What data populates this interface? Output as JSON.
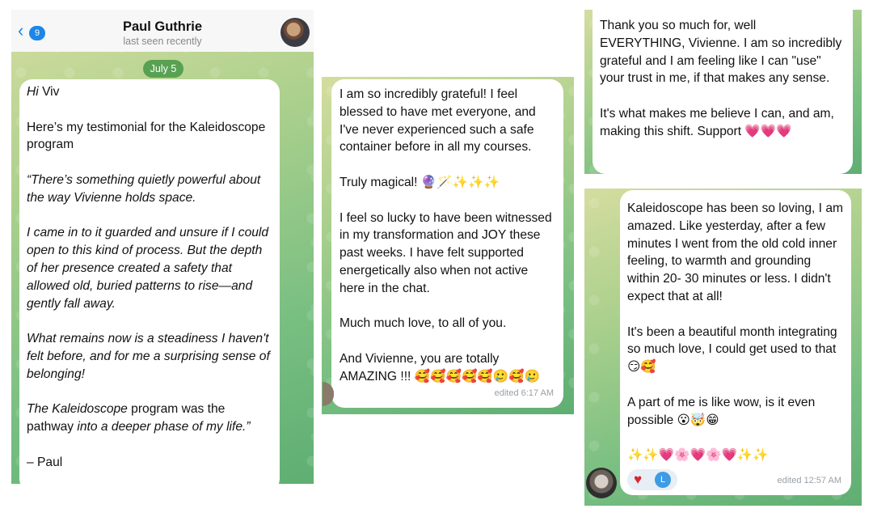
{
  "panel1": {
    "header": {
      "back_count": "9",
      "name": "Paul Guthrie",
      "status": "last seen recently"
    },
    "date": "July 5",
    "message": {
      "greeting_italic": "Hi",
      "greeting_rest": " Viv",
      "intro": "Here’s my testimonial for the Kaleidoscope program",
      "para1": "“There’s something quietly powerful about the way Vivienne holds space.",
      "para2": "I came in to it guarded and unsure if I could open to this kind of process. But the depth of her presence created a safety that allowed old, buried patterns to rise—and gently fall away.",
      "para3_a": "What remains now is a steadiness I haven't ",
      "para3_b": "felt before, and for me a surprising sense of belonging!",
      "para4_a": "The Kaleidoscope",
      "para4_b": " program was the pathway ",
      "para4_c": "into a deeper phase of my life.”",
      "signoff": "– Paul"
    }
  },
  "panel2": {
    "message": {
      "para1": "I am so incredibly grateful! I feel blessed to have met everyone, and I've never experienced such a safe container before in all my courses.",
      "para2_text": "Truly magical! ",
      "para2_emoji": "🔮🪄✨✨✨",
      "para3": "I feel so lucky to have been witnessed in my transformation and JOY these past weeks. I have felt supported energetically also when not active here in the chat.",
      "para4": "Much much love, to all of you.",
      "para5_text": "And Vivienne,  you are totally AMAZING !!! ",
      "para5_emoji": "🥰🥰🥰🥰🥰🥲🥰🥲",
      "meta": "edited 6:17 AM"
    }
  },
  "panel3": {
    "message": {
      "para1": "Thank you so much for, well EVERYTHING, Vivienne. I am so incredibly grateful and I am feeling like I can \"use\" your trust in me, if that makes any sense.",
      "para2_text": "It's what makes me believe I can, and am, making this shift. Support ",
      "para2_emoji": "💗💗💗"
    }
  },
  "panel4": {
    "message": {
      "para1": "Kaleidoscope has been so loving, I am amazed. Like yesterday, after a few minutes I went from the old cold inner feeling, to warmth and grounding within 20- 30 minutes or less. I didn't expect that at all!",
      "para2_text": "It's been a beautiful month integrating so much love, I could get used to that ",
      "para2_emoji": "😏🥰",
      "para3_text": "A part of me is like wow, is it even possible ",
      "para3_emoji": "😮🤯😁",
      "para4_emoji": "✨✨💗🌸💗🌸💗✨✨",
      "meta": "edited 12:57 AM"
    },
    "reactions": {
      "heart": "♥",
      "avatar_letter": "L"
    }
  },
  "colors": {
    "accent": "#1d86e6",
    "chat_bg_light": "#d4dd9f",
    "chat_bg_dark": "#5fae72",
    "date_pill": "#46a046",
    "heart": "#d8262c"
  }
}
